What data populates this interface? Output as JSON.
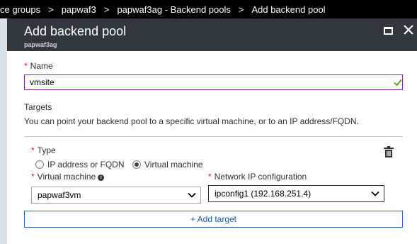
{
  "breadcrumb": {
    "items": [
      "ce groups",
      "papwaf3",
      "papwaf3ag - Backend pools",
      "Add backend pool"
    ],
    "separator": ">"
  },
  "blade": {
    "title": "Add backend pool",
    "subtitle": "papwaf3ag",
    "maximize_icon": "maximize-icon",
    "close_icon": "close-icon"
  },
  "form": {
    "name": {
      "required_mark": "*",
      "label": "Name",
      "value": "vmsite",
      "status_icon": "checkmark-icon"
    },
    "targets": {
      "title": "Targets",
      "description": "You can point your backend pool to a specific virtual machine, or to an IP address/FQDN."
    },
    "type": {
      "required_mark": "*",
      "label": "Type",
      "options": [
        "IP address or FQDN",
        "Virtual machine"
      ],
      "selected": "Virtual machine"
    },
    "virtual_machine": {
      "required_mark": "*",
      "label": "Virtual machine",
      "info_icon": "info-icon",
      "value": "papwaf3vm"
    },
    "network_ip": {
      "required_mark": "*",
      "label": "Network IP configuration",
      "value": "ipconfig1 (192.168.251.4)"
    },
    "add_target_label": "+ Add target",
    "delete_icon": "trash-icon"
  },
  "colors": {
    "breadcrumb_bg": "#000000",
    "blade_header_bg": "#32373d",
    "input_focus_border": "#8a2da5",
    "required": "#e81123",
    "valid_check": "#57a300",
    "link_blue": "#1f5ea8"
  }
}
